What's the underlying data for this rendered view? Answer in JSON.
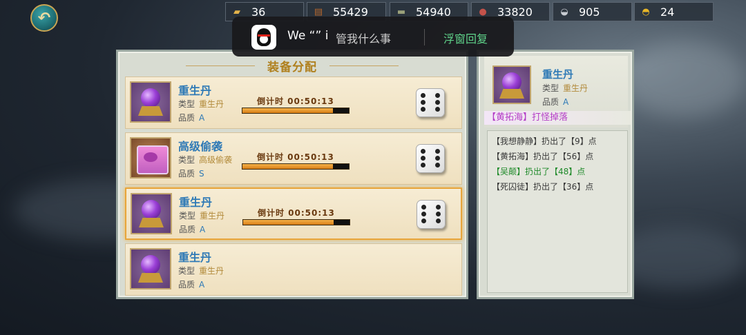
{
  "resources": [
    {
      "icon": "token-icon",
      "value": "36"
    },
    {
      "icon": "wood-icon",
      "value": "55429"
    },
    {
      "icon": "stone-icon",
      "value": "54940"
    },
    {
      "icon": "ore-icon",
      "value": "33820"
    },
    {
      "icon": "silver-icon",
      "value": "905"
    },
    {
      "icon": "gold-ingot-icon",
      "value": "24"
    }
  ],
  "notification": {
    "sender": "We “” i",
    "message": "管我什么事",
    "action": "浮窗回复"
  },
  "panel": {
    "title": "装备分配",
    "items": [
      {
        "name": "重生丹",
        "type_label": "类型",
        "type": "重生丹",
        "quality_label": "品质",
        "quality": "A",
        "countdown": "倒计时 00:50:13",
        "progress": 0.85,
        "icon": "purple-orb-icon",
        "has_roll": true
      },
      {
        "name": "高级偷袭",
        "type_label": "类型",
        "type": "高级偷袭",
        "quality_label": "品质",
        "quality": "S",
        "countdown": "倒计时 00:50:13",
        "progress": 0.85,
        "icon": "scroll-icon",
        "has_roll": true
      },
      {
        "name": "重生丹",
        "type_label": "类型",
        "type": "重生丹",
        "quality_label": "品质",
        "quality": "A",
        "countdown": "倒计时 00:50:13",
        "progress": 0.85,
        "icon": "purple-orb-icon",
        "has_roll": true,
        "selected": true
      },
      {
        "name": "重生丹",
        "type_label": "类型",
        "type": "重生丹",
        "quality_label": "品质",
        "quality": "A",
        "icon": "purple-orb-icon",
        "has_roll": false
      }
    ]
  },
  "detail": {
    "name": "重生丹",
    "type_label": "类型",
    "type": "重生丹",
    "quality_label": "品质",
    "quality": "A",
    "source": "【黄拓海】打怪掉落",
    "log": [
      {
        "text": "【我想静静】扔出了【9】点",
        "highlight": false
      },
      {
        "text": "【黄拓海】扔出了【56】点",
        "highlight": false
      },
      {
        "text": "【吴颠】扔出了【48】点",
        "highlight": true
      },
      {
        "text": "【死囚徒】扔出了【36】点",
        "highlight": false
      }
    ]
  }
}
